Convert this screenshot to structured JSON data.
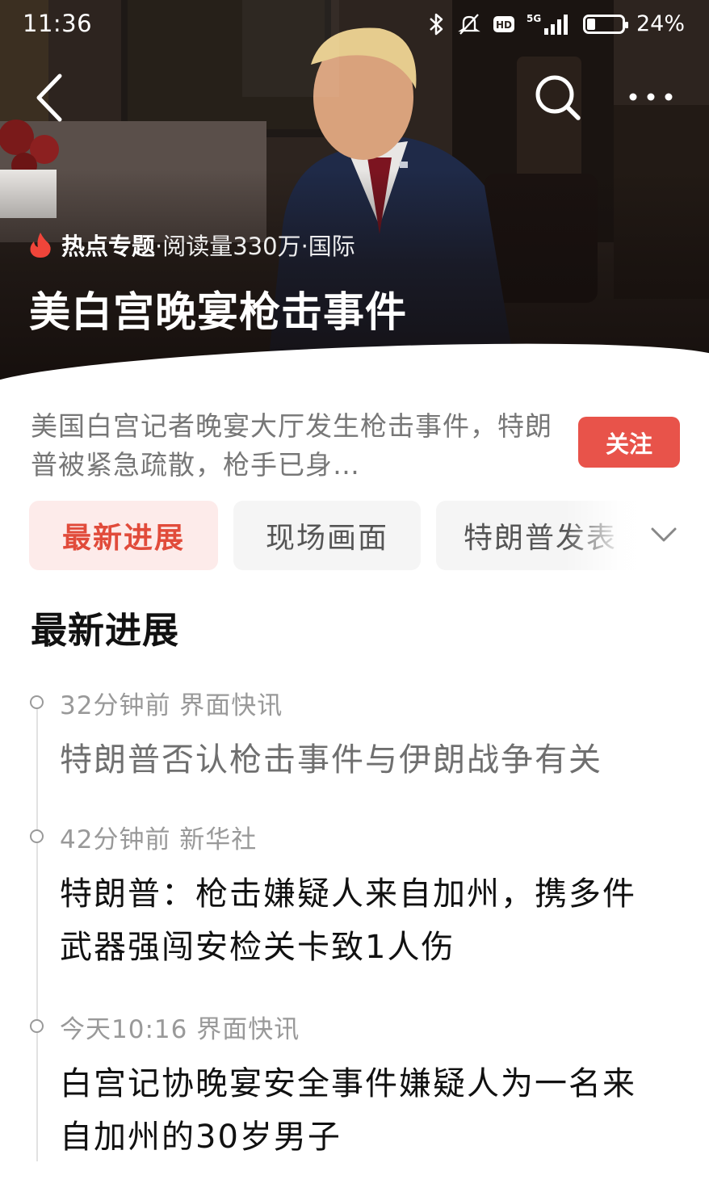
{
  "status_bar": {
    "time": "11:36",
    "network": "5G",
    "hd": "HD",
    "battery_percent": 24,
    "battery_label": "24%"
  },
  "nav": {
    "back_icon": "chevron-left-icon",
    "search_icon": "search-icon",
    "more_icon": "more-dots-icon"
  },
  "hero": {
    "meta_tag": "热点专题",
    "meta_rest": "·阅读量330万·国际",
    "title": "美白宫晚宴枪击事件"
  },
  "summary": {
    "text": "美国白宫记者晚宴大厅发生枪击事件，特朗普被紧急疏散，枪手已身…",
    "follow_label": "关注"
  },
  "tabs": [
    {
      "label": "最新进展",
      "active": true
    },
    {
      "label": "现场画面",
      "active": false
    },
    {
      "label": "特朗普发表",
      "active": false
    }
  ],
  "section": {
    "title": "最新进展"
  },
  "timeline": [
    {
      "meta": "32分钟前 界面快讯",
      "title": "特朗普否认枪击事件与伊朗战争有关",
      "read": true
    },
    {
      "meta": "42分钟前 新华社",
      "title": "特朗普：枪击嫌疑人来自加州，携多件武器强闯安检关卡致1人伤",
      "read": false
    },
    {
      "meta": "今天10:16 界面快讯",
      "title": "白宫记协晚宴安全事件嫌疑人为一名来自加州的30岁男子",
      "read": false
    }
  ],
  "colors": {
    "accent": "#e8534a",
    "active_tab_bg": "#fdebea",
    "active_tab_text": "#e14b3b"
  }
}
